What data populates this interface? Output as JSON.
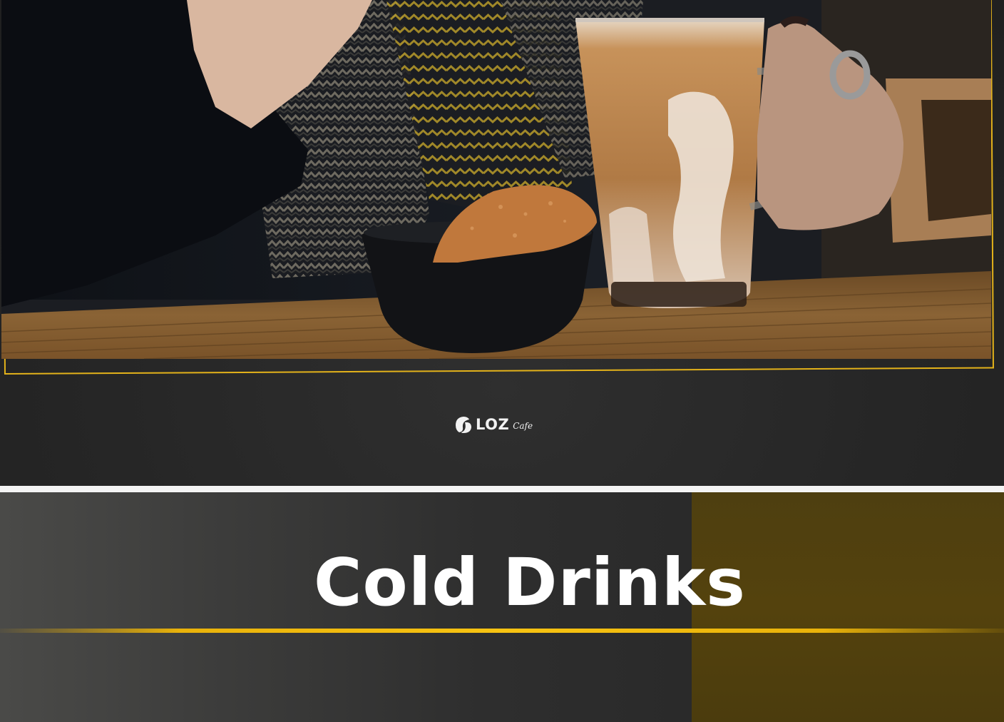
{
  "brand": {
    "logo_word": "LOZ",
    "logo_sub": "Cafe"
  },
  "section": {
    "title": "Cold Drinks"
  },
  "colors": {
    "accent_gold": "#e9b20a",
    "page_dark": "#262626",
    "panel_olive": "#54420d",
    "separator": "#f4f4f4"
  },
  "images": {
    "hero_photo": "iced-latte-with-biscuit-photo",
    "logo_icon": "coffee-bean-icon"
  }
}
